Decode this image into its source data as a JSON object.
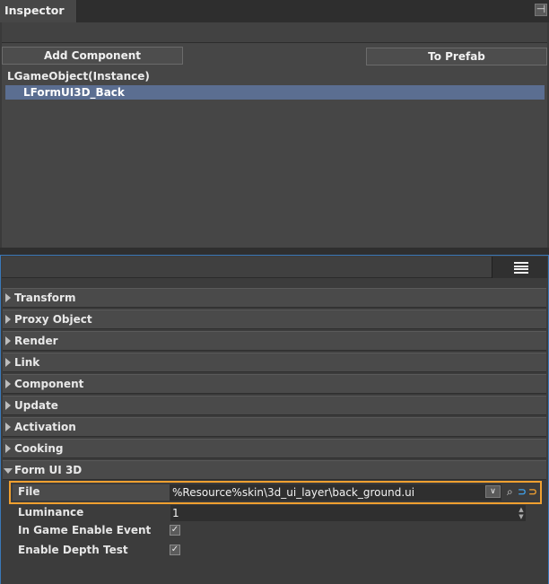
{
  "window": {
    "title": "Inspector",
    "pin_icon": "pin-icon"
  },
  "actions": {
    "add_component": "Add Component",
    "to_prefab": "To Prefab"
  },
  "hierarchy": {
    "root": "LGameObject(Instance)",
    "selected_child": "LFormUI3D_Back"
  },
  "properties_toolbar": {
    "menu_icon": "menu-icon"
  },
  "sections": [
    {
      "label": "Transform",
      "expanded": false
    },
    {
      "label": "Proxy Object",
      "expanded": false
    },
    {
      "label": "Render",
      "expanded": false
    },
    {
      "label": "Link",
      "expanded": false
    },
    {
      "label": "Component",
      "expanded": false
    },
    {
      "label": "Update",
      "expanded": false
    },
    {
      "label": "Activation",
      "expanded": false
    },
    {
      "label": "Cooking",
      "expanded": false
    },
    {
      "label": "Form UI 3D",
      "expanded": true
    }
  ],
  "form_ui_3d": {
    "file": {
      "label": "File",
      "value": "%Resource%skin\\3d_ui_layer\\back_ground.ui",
      "highlight_color": "#f0a030"
    },
    "luminance": {
      "label": "Luminance",
      "value": "1"
    },
    "in_game_enable_event": {
      "label": "In Game Enable Event",
      "checked": true
    },
    "enable_depth_test": {
      "label": "Enable Depth Test",
      "checked": true
    }
  },
  "colors": {
    "selection": "#5b6e91",
    "panel_focus_border": "#3a78b8",
    "highlight": "#f0a030"
  }
}
